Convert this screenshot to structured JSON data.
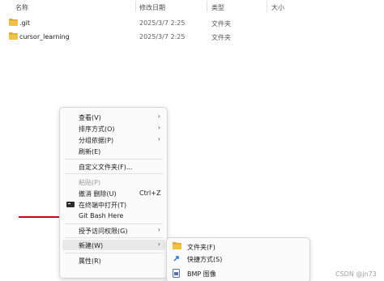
{
  "columns": {
    "name": "名称",
    "modified": "修改日期",
    "type": "类型",
    "size": "大小"
  },
  "files": [
    {
      "name": ".git",
      "modified": "2025/3/7 2:25",
      "type": "文件夹"
    },
    {
      "name": "cursor_learning",
      "modified": "2025/3/7 2:25",
      "type": "文件夹"
    }
  ],
  "menu": {
    "view": "查看(V)",
    "sort": "排序方式(O)",
    "group": "分组依据(P)",
    "refresh": "刷新(E)",
    "customize": "自定义文件夹(F)...",
    "paste": "粘贴(P)",
    "undo": "撤消 删除(U)",
    "undo_shortcut": "Ctrl+Z",
    "open_terminal": "在终端中打开(T)",
    "git_bash": "Git Bash Here",
    "give_access": "授予访问权限(G)",
    "new": "新建(W)",
    "properties": "属性(R)"
  },
  "submenu": {
    "folder": "文件夹(F)",
    "shortcut": "快捷方式(S)",
    "bmp": "BMP 图像"
  },
  "watermark": "CSDN @jn73",
  "colors": {
    "folder": "#f0c04a",
    "folder_dark": "#e0a92c",
    "underline": "#d0021b",
    "shortcut_arrow": "#1a73e8"
  }
}
